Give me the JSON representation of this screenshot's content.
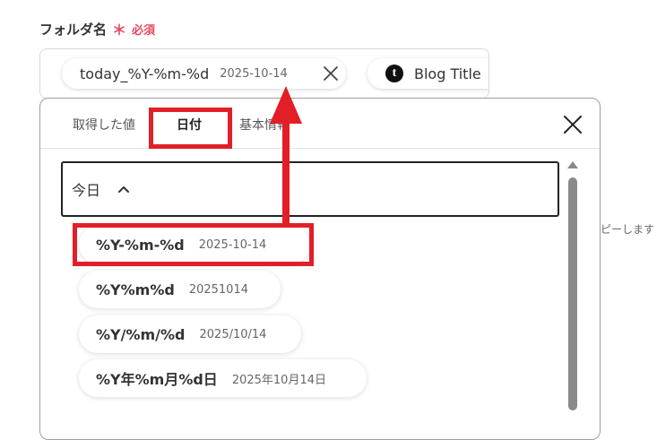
{
  "field": {
    "label": "フォルダ名",
    "required_mark": "＊",
    "required_text": "必須"
  },
  "input": {
    "chips": [
      {
        "code": "today_%Y-%m-%d",
        "value": "2025-10-14",
        "remove_icon": "close-icon"
      },
      {
        "icon": "tumblr-icon",
        "icon_glyph": "t",
        "label": "Blog Title"
      }
    ]
  },
  "tabs": {
    "items": [
      {
        "label": "取得した値"
      },
      {
        "label": "日付",
        "active": true
      },
      {
        "label": "基本情報"
      }
    ],
    "close_icon": "close-icon"
  },
  "selector": {
    "selected": "今日",
    "chevron_icon": "chevron-up-icon"
  },
  "options": [
    {
      "format": "%Y-%m-%d",
      "example": "2025-10-14",
      "highlighted": true
    },
    {
      "format": "%Y%m%d",
      "example": "20251014"
    },
    {
      "format": "%Y/%m/%d",
      "example": "2025/10/14"
    },
    {
      "format": "%Y年%m月%d日",
      "example": "2025年10月14日"
    }
  ],
  "side_text": "ピーします",
  "colors": {
    "accent_red": "#e21f26",
    "required_red": "#e84a5f",
    "text_dark": "#333333",
    "scrollbar": "#8a8a8a"
  }
}
